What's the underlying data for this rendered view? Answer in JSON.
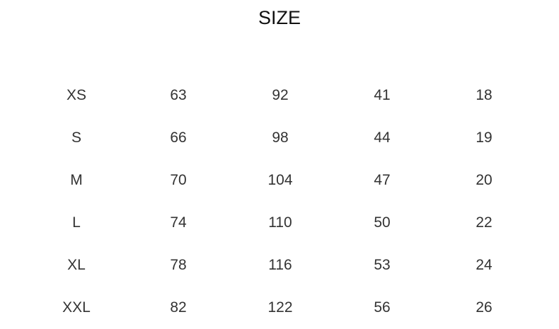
{
  "title": "SIZE",
  "rows": [
    [
      "XS",
      "63",
      "92",
      "41",
      "18"
    ],
    [
      "S",
      "66",
      "98",
      "44",
      "19"
    ],
    [
      "M",
      "70",
      "104",
      "47",
      "20"
    ],
    [
      "L",
      "74",
      "110",
      "50",
      "22"
    ],
    [
      "XL",
      "78",
      "116",
      "53",
      "24"
    ],
    [
      "XXL",
      "82",
      "122",
      "56",
      "26"
    ]
  ]
}
